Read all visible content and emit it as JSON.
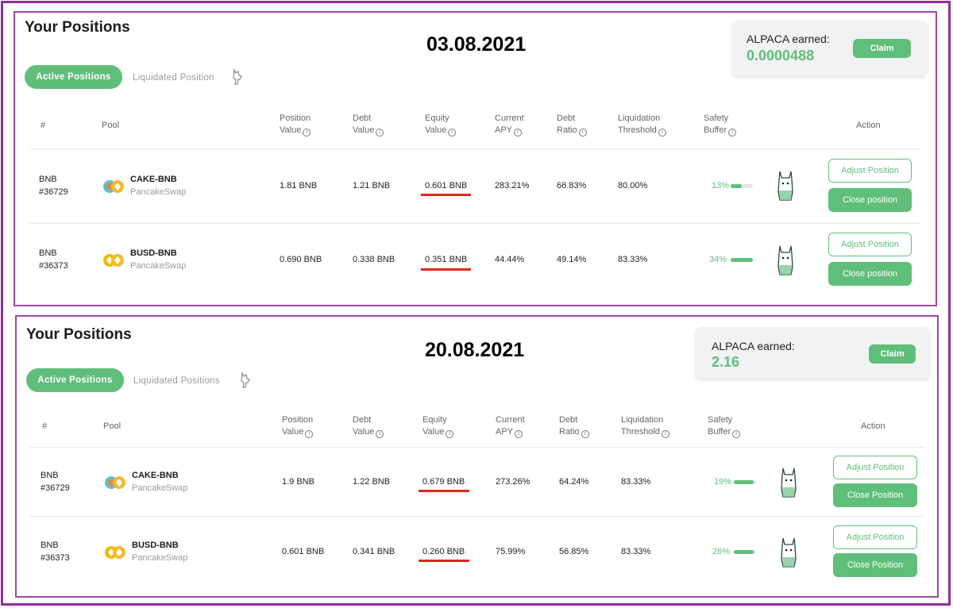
{
  "colors": {
    "accent": "#5fbf7a",
    "frame": "#8e2f97",
    "highlight": "#e3251d"
  },
  "snapshots": [
    {
      "title": "Your Positions",
      "date": "03.08.2021",
      "tabs": {
        "active": "Active Positions",
        "inactive": "Liquidated Position"
      },
      "earned": {
        "label": "ALPACA earned:",
        "value": "0.0000488",
        "claim": "Claim"
      },
      "headers": {
        "num": "#",
        "pool": "Pool",
        "position_value": [
          "Position",
          "Value"
        ],
        "debt_value": [
          "Debt",
          "Value"
        ],
        "equity_value": [
          "Equity",
          "Value"
        ],
        "current_apy": [
          "Current",
          "APY"
        ],
        "debt_ratio": [
          "Debt",
          "Ratio"
        ],
        "liq_threshold": [
          "Liquidation",
          "Threshold"
        ],
        "safety_buffer": [
          "Safety",
          "Buffer"
        ],
        "action": "Action"
      },
      "rows": [
        {
          "asset": "BNB",
          "id": "#36729",
          "pair": "CAKE-BNB",
          "dex": "PancakeSwap",
          "coin_icon": "cake-bnb-icon",
          "position_value": "1.81 BNB",
          "debt_value": "1.21 BNB",
          "equity_value": "0.601 BNB",
          "apy": "283.21%",
          "debt_ratio": "66.83%",
          "liq_threshold": "80.00%",
          "safety_buffer": "13%",
          "safety_fill": 0.5,
          "adjust": "Adjust Position",
          "close": "Close position"
        },
        {
          "asset": "BNB",
          "id": "#36373",
          "pair": "BUSD-BNB",
          "dex": "PancakeSwap",
          "coin_icon": "busd-bnb-icon",
          "position_value": "0.690 BNB",
          "debt_value": "0.338 BNB",
          "equity_value": "0.351 BNB",
          "apy": "44.44%",
          "debt_ratio": "49.14%",
          "liq_threshold": "83.33%",
          "safety_buffer": "34%",
          "safety_fill": 1.0,
          "adjust": "Adjust Position",
          "close": "Close position"
        }
      ]
    },
    {
      "title": "Your Positions",
      "date": "20.08.2021",
      "tabs": {
        "active": "Active Positions",
        "inactive": "Liquidated Positions"
      },
      "earned": {
        "label": "ALPACA earned:",
        "value": "2.16",
        "claim": "Claim"
      },
      "headers": {
        "num": "#",
        "pool": "Pool",
        "position_value": [
          "Position",
          "Value"
        ],
        "debt_value": [
          "Debt",
          "Value"
        ],
        "equity_value": [
          "Equity",
          "Value"
        ],
        "current_apy": [
          "Current",
          "APY"
        ],
        "debt_ratio": [
          "Debt",
          "Ratio"
        ],
        "liq_threshold": [
          "Liquidation",
          "Threshold"
        ],
        "safety_buffer": [
          "Safety",
          "Buffer"
        ],
        "action": "Action"
      },
      "rows": [
        {
          "asset": "BNB",
          "id": "#36729",
          "pair": "CAKE-BNB",
          "dex": "PancakeSwap",
          "coin_icon": "cake-bnb-icon",
          "position_value": "1.9 BNB",
          "debt_value": "1.22 BNB",
          "equity_value": "0.679 BNB",
          "apy": "273.26%",
          "debt_ratio": "64.24%",
          "liq_threshold": "83.33%",
          "safety_buffer": "19%",
          "safety_fill": 0.9,
          "adjust": "Adjust Position",
          "close": "Close Position"
        },
        {
          "asset": "BNB",
          "id": "#36373",
          "pair": "BUSD-BNB",
          "dex": "PancakeSwap",
          "coin_icon": "busd-bnb-icon",
          "position_value": "0.601 BNB",
          "debt_value": "0.341 BNB",
          "equity_value": "0.260 BNB",
          "apy": "75.99%",
          "debt_ratio": "56.85%",
          "liq_threshold": "83.33%",
          "safety_buffer": "26%",
          "safety_fill": 0.9,
          "adjust": "Adjust Position",
          "close": "Close Position"
        }
      ]
    }
  ]
}
